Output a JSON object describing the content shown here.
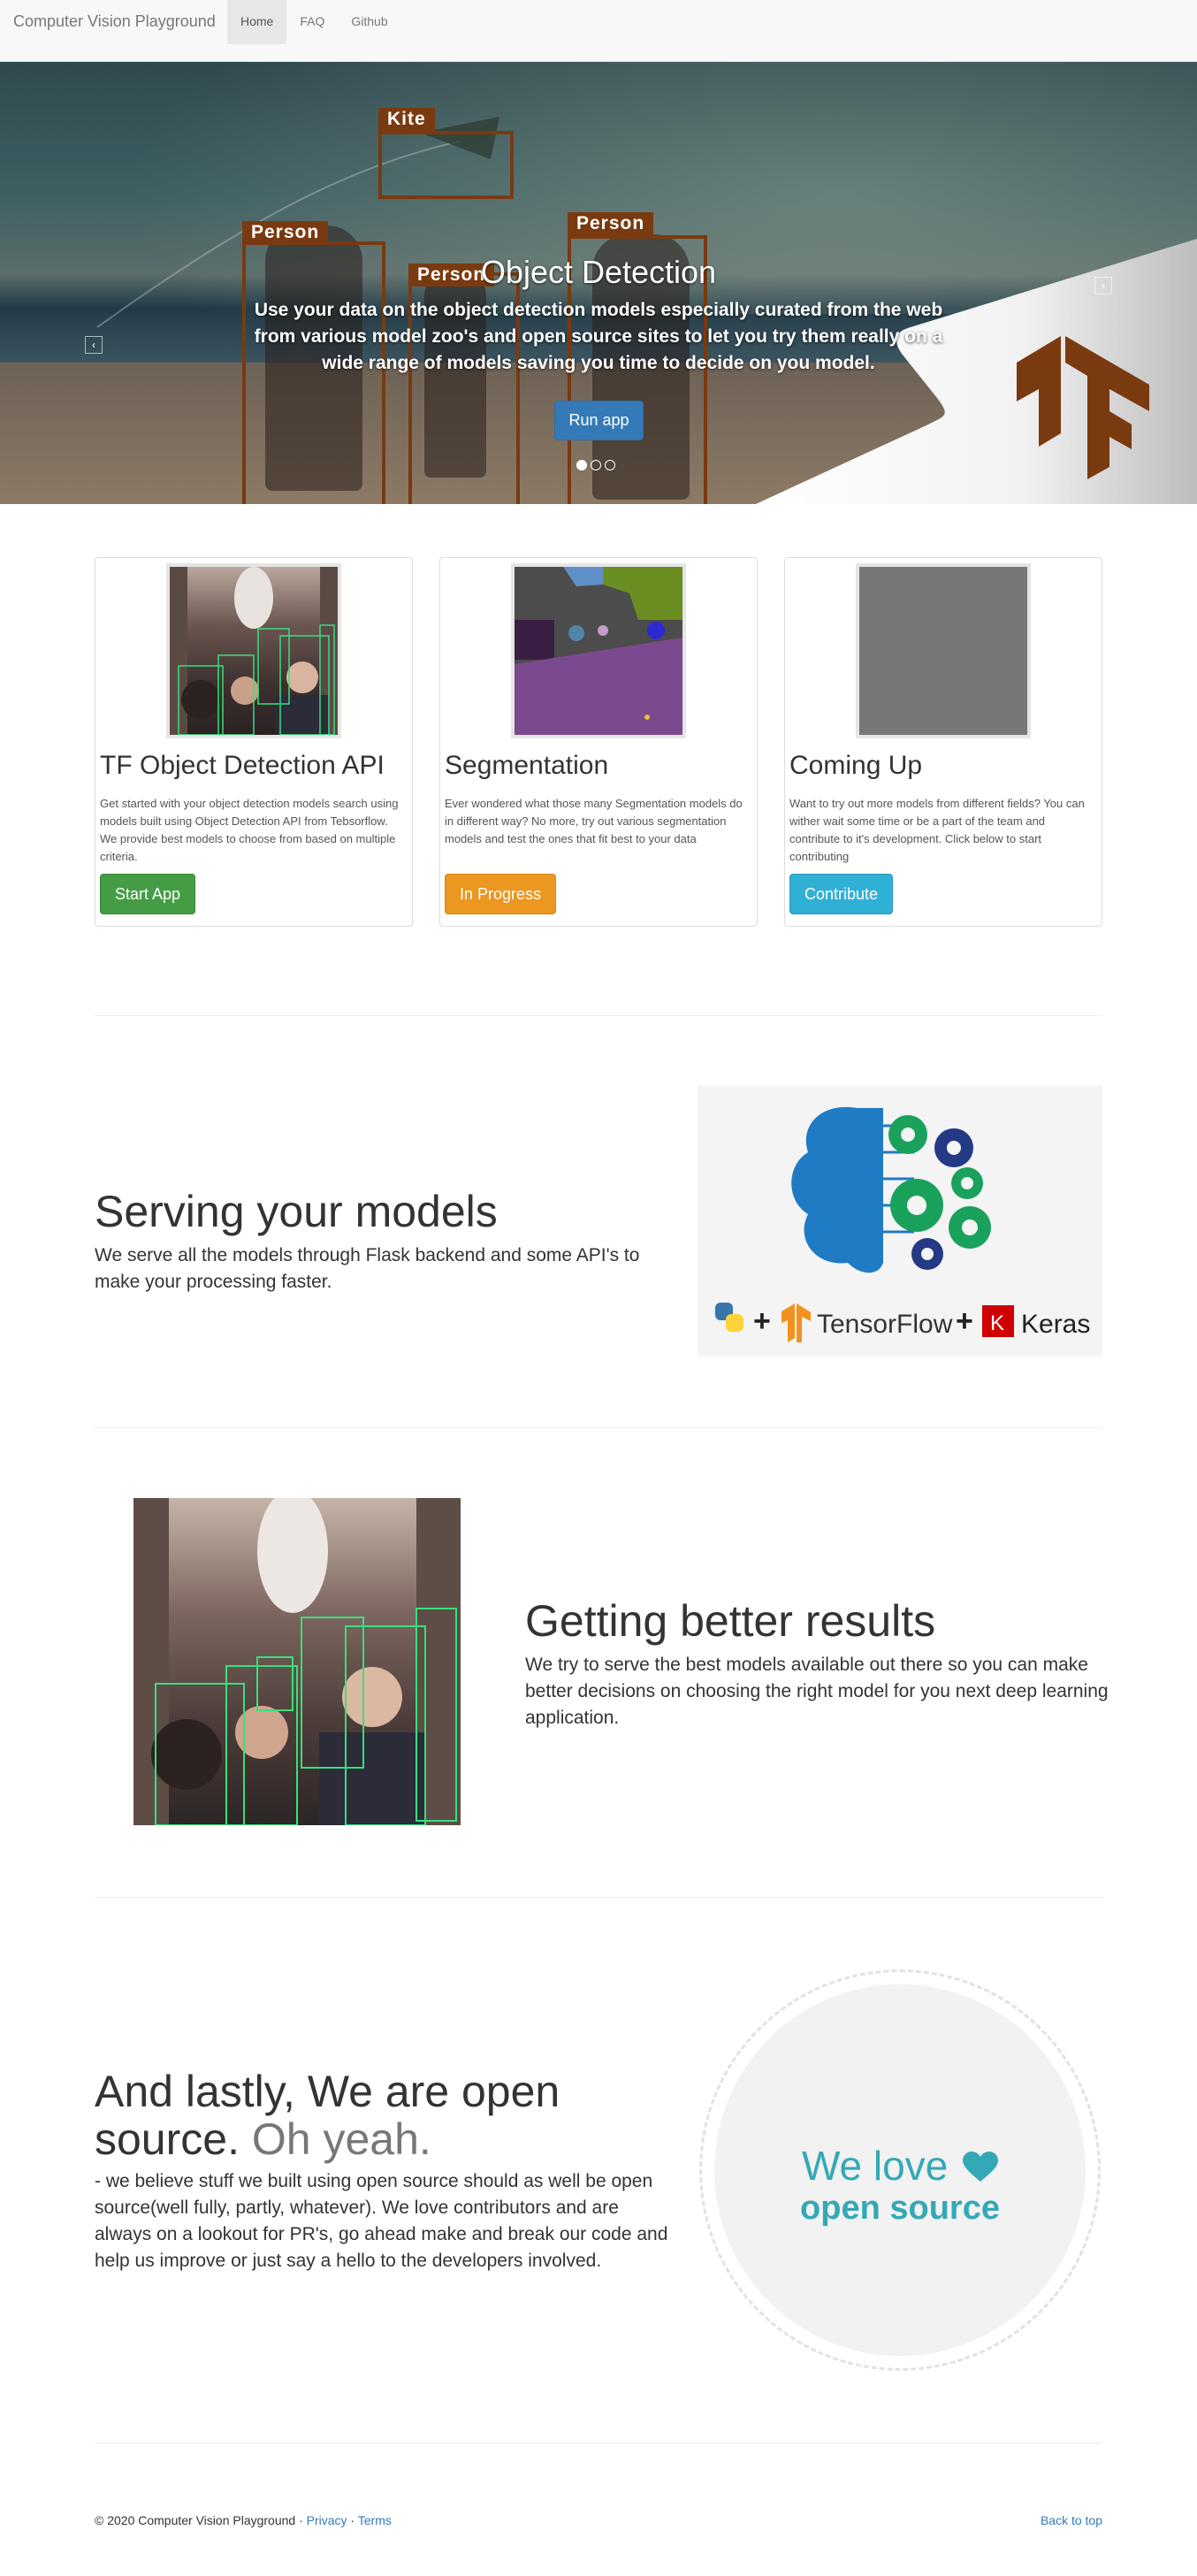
{
  "navbar": {
    "brand": "Computer Vision Playground",
    "items": [
      {
        "label": "Home",
        "active": true
      },
      {
        "label": "FAQ",
        "active": false
      },
      {
        "label": "Github",
        "active": false
      }
    ]
  },
  "hero": {
    "title": "Object Detection",
    "text": "Use your data on the object detection models especially curated from the web from various model zoo's and open source sites to let you try them really on a wide range of models saving you time to decide on you model.",
    "button": "Run app",
    "labels": {
      "kite": "Kite",
      "person1": "Person",
      "person2": "Person",
      "person3": "Person"
    },
    "slides": 3,
    "active_slide": 1,
    "box_color": "#7a3a10",
    "logo_color": "#7a3a10"
  },
  "cards": [
    {
      "title": "TF Object Detection API",
      "text": "Get started with your object detection models search using models built using Object Detection API from Tebsorflow. We provide best models to choose from based on multiple criteria.",
      "button": "Start App",
      "button_color": "#449d44"
    },
    {
      "title": "Segmentation",
      "text": "Ever wondered what those many Segmentation models do in different way? No more, try out various segmentation models and test the ones that fit best to your data",
      "button": "In Progress",
      "button_color": "#ec971f"
    },
    {
      "title": "Coming Up",
      "text": "Want to try out more models from different fields? You can wither wait some time or be a part of the team and contribute to it's development. Click below to start contributing",
      "button": "Contribute",
      "button_color": "#31b0d5"
    }
  ],
  "feature1": {
    "heading": "Serving your models",
    "text": "We serve all the models through Flask backend and some API's to make your processing faster.",
    "image_labels": {
      "tf": "TensorFlow",
      "keras": "Keras",
      "keras_letter": "K",
      "plus": "+"
    }
  },
  "feature2": {
    "heading": "Getting better results",
    "text": "We try to serve the best models available out there so you can make better decisions on choosing the right model for you next deep learning application."
  },
  "feature3": {
    "heading": "And lastly, We are open source.",
    "heading_muted": "Oh yeah.",
    "text": "- we believe stuff we built using open source should as well be open source(well fully, partly, whatever). We love contributors and are always on a lookout for PR's, go ahead make and break our code and help us improve or just say a hello to the developers involved.",
    "badge_line1": "We love",
    "badge_line2": "open source",
    "badge_color": "#35a8b6"
  },
  "footer": {
    "copyright": "© 2020 Computer Vision Playground · ",
    "privacy": "Privacy",
    "sep": " · ",
    "terms": "Terms",
    "back_to_top": "Back to top"
  }
}
